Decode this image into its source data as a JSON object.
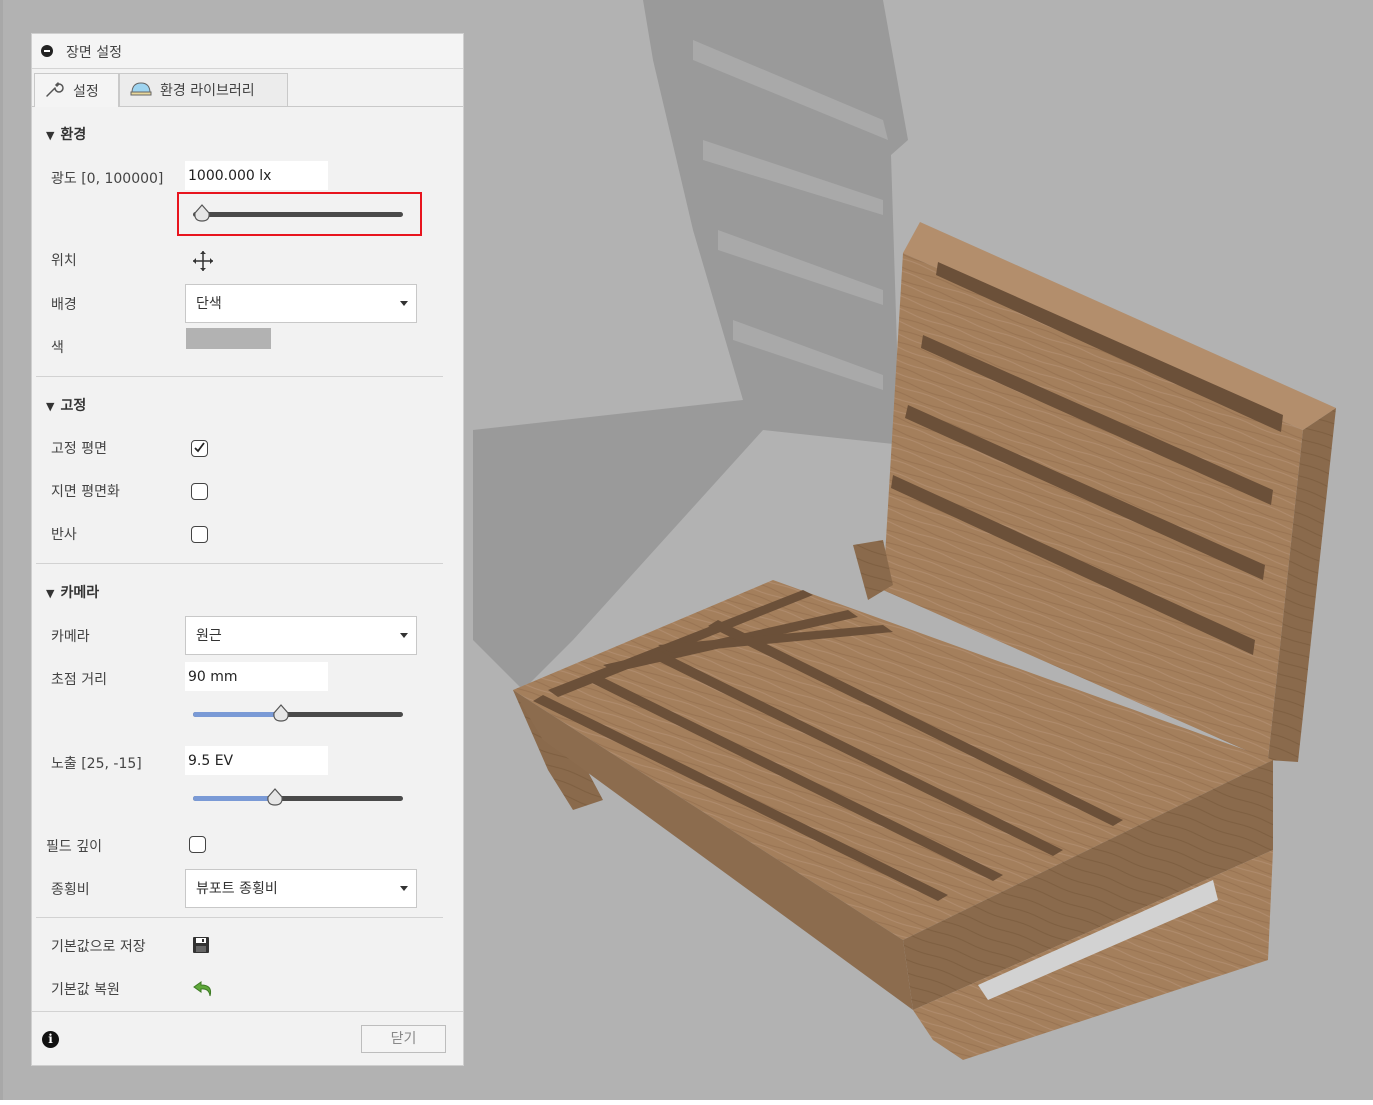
{
  "panel": {
    "title": "장면 설정",
    "tabs": [
      {
        "label": "설정",
        "icon": "wrench-icon",
        "active": true
      },
      {
        "label": "환경 라이브러리",
        "icon": "environment-dome-icon",
        "active": false
      }
    ],
    "environment": {
      "header": "환경",
      "brightness_label": "광도 [0, 100000]",
      "brightness_value": "1000.000 lx",
      "brightness_slider_fraction": 0.01,
      "position_label": "위치",
      "background_label": "배경",
      "background_value": "단색",
      "color_label": "색",
      "color_value": "#b2b2b2"
    },
    "ground": {
      "header": "고정",
      "ground_plane_label": "고정 평면",
      "ground_plane_checked": true,
      "flatten_ground_label": "지면 평면화",
      "flatten_ground_checked": false,
      "reflections_label": "반사",
      "reflections_checked": false
    },
    "camera": {
      "header": "카메라",
      "camera_label": "카메라",
      "camera_value": "원근",
      "focal_length_label": "초점 거리",
      "focal_length_value": "90 mm",
      "focal_length_slider_fraction": 0.42,
      "exposure_label": "노출 [25, -15]",
      "exposure_value": "9.5 EV",
      "exposure_slider_fraction": 0.39,
      "dof_label": "필드 깊이",
      "dof_checked": false,
      "aspect_label": "종횡비",
      "aspect_value": "뷰포트 종횡비"
    },
    "save_default_label": "기본값으로 저장",
    "restore_default_label": "기본값 복원",
    "close_label": "닫기"
  },
  "colors": {
    "viewport_background": "#b2b2b2",
    "highlight": "#e8141e",
    "slider_fill": "#7a9ad6",
    "wood": "#a47f5c"
  }
}
